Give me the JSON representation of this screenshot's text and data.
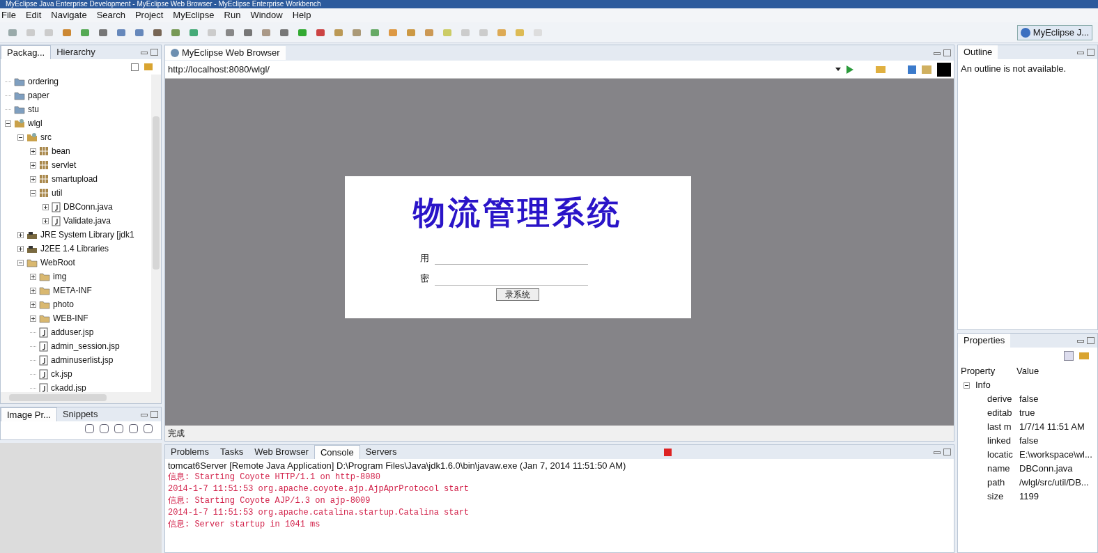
{
  "window": {
    "title": "MyEclipse Java Enterprise Development - MyEclipse Web Browser - MyEclipse Enterprise Workbench"
  },
  "menu": [
    "File",
    "Edit",
    "Navigate",
    "Search",
    "Project",
    "MyEclipse",
    "Run",
    "Window",
    "Help"
  ],
  "perspective": {
    "label": "MyEclipse J..."
  },
  "explorer": {
    "tabs": [
      {
        "label": "Packag...",
        "selected": true
      },
      {
        "label": "Hierarchy",
        "selected": false
      }
    ],
    "tree": [
      {
        "label": "ordering",
        "kind": "folder"
      },
      {
        "label": "paper",
        "kind": "folder"
      },
      {
        "label": "stu",
        "kind": "folder"
      },
      {
        "label": "wlgl",
        "kind": "project",
        "expanded": true,
        "children": [
          {
            "label": "src",
            "kind": "srcfolder",
            "expanded": true,
            "children": [
              {
                "label": "bean",
                "kind": "package",
                "expanded": false
              },
              {
                "label": "servlet",
                "kind": "package",
                "expanded": false
              },
              {
                "label": "smartupload",
                "kind": "package",
                "expanded": false
              },
              {
                "label": "util",
                "kind": "package",
                "expanded": true,
                "children": [
                  {
                    "label": "DBConn.java",
                    "kind": "java",
                    "expanded": false
                  },
                  {
                    "label": "Validate.java",
                    "kind": "java",
                    "expanded": false
                  }
                ]
              }
            ]
          },
          {
            "label": "JRE System Library [jdk1",
            "kind": "library",
            "expanded": false
          },
          {
            "label": "J2EE 1.4 Libraries",
            "kind": "library",
            "expanded": false
          },
          {
            "label": "WebRoot",
            "kind": "openfolder",
            "expanded": true,
            "children": [
              {
                "label": "img",
                "kind": "openfolder",
                "expanded": false
              },
              {
                "label": "META-INF",
                "kind": "openfolder",
                "expanded": false
              },
              {
                "label": "photo",
                "kind": "openfolder",
                "expanded": false
              },
              {
                "label": "WEB-INF",
                "kind": "openfolder",
                "expanded": false
              },
              {
                "label": "adduser.jsp",
                "kind": "jsp"
              },
              {
                "label": "admin_session.jsp",
                "kind": "jsp"
              },
              {
                "label": "adminuserlist.jsp",
                "kind": "jsp"
              },
              {
                "label": "ck.jsp",
                "kind": "jsp"
              },
              {
                "label": "ckadd.jsp",
                "kind": "jsp"
              }
            ]
          }
        ]
      }
    ]
  },
  "image_panel": {
    "tabs": [
      {
        "label": "Image Pr...",
        "selected": true
      },
      {
        "label": "Snippets",
        "selected": false
      }
    ]
  },
  "browser": {
    "tab": "MyEclipse Web Browser",
    "url": "http://localhost:8080/wlgl/",
    "status": "完成",
    "page": {
      "title": "物流管理系统",
      "fields": [
        {
          "label": "用"
        },
        {
          "label": "密"
        }
      ],
      "button": "录系统"
    }
  },
  "console": {
    "tabs": [
      {
        "label": "Problems",
        "selected": false
      },
      {
        "label": "Tasks",
        "selected": false
      },
      {
        "label": "Web Browser",
        "selected": false
      },
      {
        "label": "Console",
        "selected": true
      },
      {
        "label": "Servers",
        "selected": false
      }
    ],
    "header": "tomcat6Server [Remote Java Application] D:\\Program Files\\Java\\jdk1.6.0\\bin\\javaw.exe (Jan 7, 2014 11:51:50 AM)",
    "lines": [
      "信息: Starting Coyote HTTP/1.1 on http-8080",
      "2014-1-7 11:51:53 org.apache.coyote.ajp.AjpAprProtocol start",
      "信息: Starting Coyote AJP/1.3 on ajp-8009",
      "2014-1-7 11:51:53 org.apache.catalina.startup.Catalina start",
      "信息: Server startup in 1041 ms"
    ]
  },
  "outline": {
    "tab": "Outline",
    "message": "An outline is not available."
  },
  "properties": {
    "tab": "Properties",
    "columns": [
      "Property",
      "Value"
    ],
    "group": {
      "label": "Info",
      "expanded": true
    },
    "rows": [
      {
        "key": "derive",
        "value": "false"
      },
      {
        "key": "editab",
        "value": "true"
      },
      {
        "key": "last m",
        "value": "1/7/14 11:51 AM"
      },
      {
        "key": "linked",
        "value": "false"
      },
      {
        "key": "locatic",
        "value": "E:\\workspace\\wl..."
      },
      {
        "key": "name",
        "value": "DBConn.java"
      },
      {
        "key": "path",
        "value": "/wlgl/src/util/DB..."
      },
      {
        "key": "size",
        "value": "1199"
      }
    ]
  }
}
